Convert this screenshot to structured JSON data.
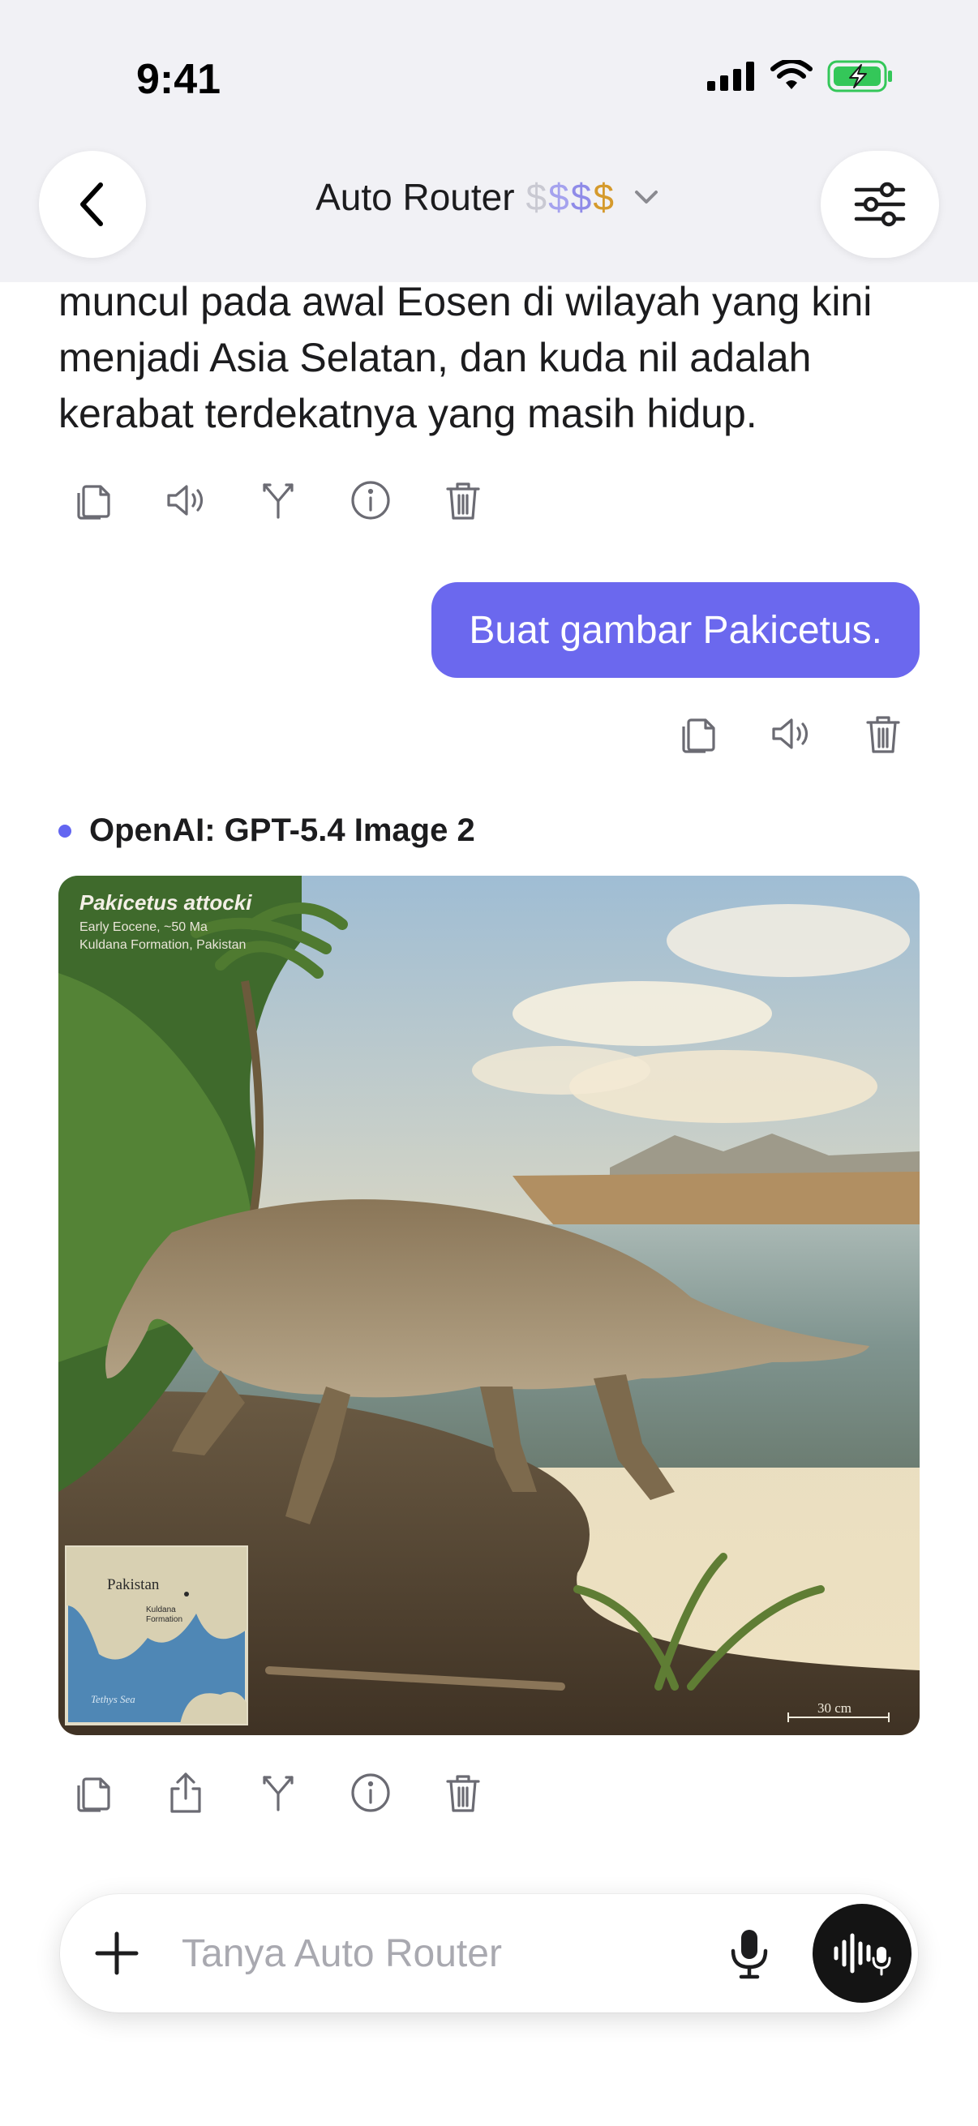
{
  "status_bar": {
    "time": "9:41"
  },
  "header": {
    "title": "Auto Router",
    "price_tier": [
      "$",
      "$",
      "$",
      "$"
    ],
    "back_icon": "chevron-left-icon",
    "settings_icon": "sliders-icon"
  },
  "messages": {
    "assistant_text": "muncul pada awal Eosen di wilayah yang kini menjadi Asia Selatan, dan kuda nil adalah kerabat terdekatnya yang masih hidup.",
    "user_text": "Buat gambar Pakicetus.",
    "model_name": "OpenAI: GPT-5.4 Image 2",
    "image": {
      "title": "Pakicetus attocki",
      "subtitle_1": "Early Eocene, ~50 Ma",
      "subtitle_2": "Kuldana Formation, Pakistan",
      "map_country": "Pakistan",
      "map_location_1": "Kuldana",
      "map_location_2": "Formation",
      "map_sea": "Tethys Sea",
      "scale_label": "30 cm"
    }
  },
  "composer": {
    "placeholder": "Tanya Auto Router"
  },
  "colors": {
    "accent": "#6b68ee",
    "model_dot": "#6366f1",
    "price_gold": "#d59a2c",
    "battery_green": "#34c759"
  }
}
